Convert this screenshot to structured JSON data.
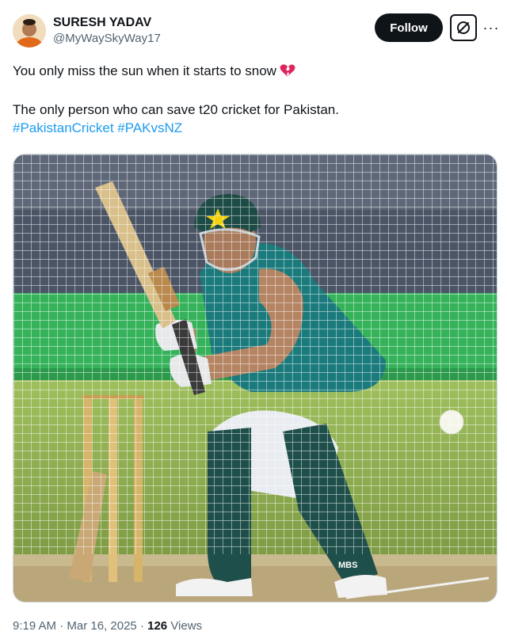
{
  "author": {
    "display_name": "SURESH YADAV",
    "handle": "@MyWaySkyWay17",
    "avatar_icon": "avatar-photo"
  },
  "actions": {
    "follow_label": "Follow",
    "grok_icon": "slashed-circle-icon",
    "more_icon": "more-dots-icon",
    "more_text": "···"
  },
  "tweet": {
    "line_1": "You only miss the sun when it starts to snow",
    "line_1_emoji": "broken-heart-icon",
    "line_2": "The only person who can save t20 cricket for Pakistan.",
    "hashtags": [
      "#PakistanCricket",
      "#PAKvsNZ"
    ]
  },
  "media": {
    "description_icon": "cricket-practice-photo",
    "pad_brand": "MBS"
  },
  "meta": {
    "time": "9:19 AM",
    "separator": " · ",
    "date": "Mar 16, 2025",
    "views_count": "126",
    "views_label": " Views"
  },
  "colors": {
    "text": "#0f1419",
    "secondary": "#536471",
    "link": "#1d9bf0",
    "heart": "#e0245e"
  }
}
